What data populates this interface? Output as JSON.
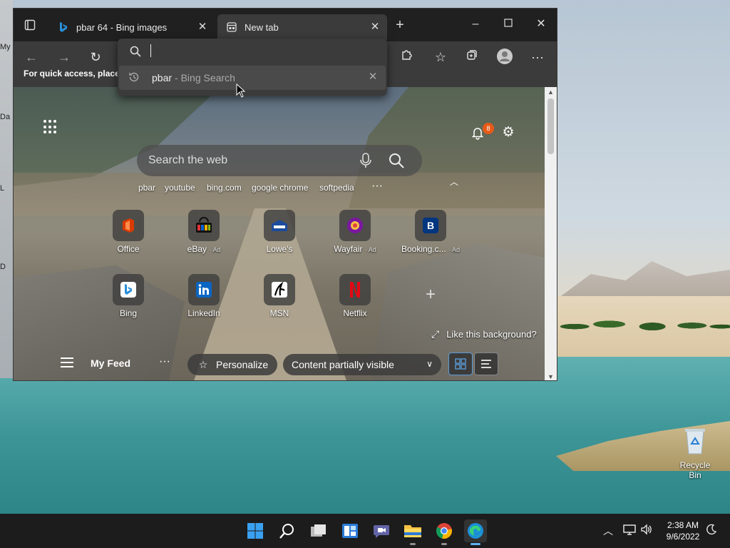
{
  "desktop": {
    "left_labels": [
      "My",
      "Da",
      "L",
      "D"
    ],
    "recycle_bin_label": "Recycle Bin"
  },
  "browser": {
    "tabs": [
      {
        "title": "pbar 64 - Bing images",
        "active": false,
        "icon": "bing-icon"
      },
      {
        "title": "New tab",
        "active": true,
        "icon": "newtab-page-icon"
      }
    ],
    "favorites_bar_text": "For quick access, place y",
    "address_bar": {
      "value": "",
      "suggestion": {
        "query": "pbar",
        "source": " - Bing Search"
      }
    }
  },
  "newtab": {
    "search_placeholder": "Search the web",
    "notification_count": "8",
    "quick_links": [
      "pbar",
      "youtube",
      "bing.com",
      "google chrome",
      "softpedia"
    ],
    "tiles_row1": [
      {
        "label": "Office",
        "ad": "",
        "icon": "office-icon"
      },
      {
        "label": "eBay",
        "ad": "· Ad",
        "icon": "ebay-icon"
      },
      {
        "label": "Lowe's",
        "ad": "",
        "icon": "lowes-icon"
      },
      {
        "label": "Wayfair",
        "ad": "· Ad",
        "icon": "wayfair-icon"
      },
      {
        "label": "Booking.c...",
        "ad": "· Ad",
        "icon": "booking-icon"
      }
    ],
    "tiles_row2": [
      {
        "label": "Bing",
        "ad": "",
        "icon": "bing-icon"
      },
      {
        "label": "LinkedIn",
        "ad": "",
        "icon": "linkedin-icon"
      },
      {
        "label": "MSN",
        "ad": "",
        "icon": "msn-icon"
      },
      {
        "label": "Netflix",
        "ad": "",
        "icon": "netflix-icon"
      }
    ],
    "like_background": "Like this background?",
    "feed": {
      "title": "My Feed",
      "personalize": "Personalize",
      "content_visibility": "Content partially visible"
    }
  },
  "taskbar": {
    "time": "2:38 AM",
    "date": "9/6/2022",
    "apps": [
      "start",
      "search",
      "task-view",
      "widgets",
      "teams-chat",
      "file-explorer",
      "chrome",
      "edge"
    ]
  },
  "colors": {
    "accent": "#5fb2f2",
    "badge": "#e85a17",
    "browser_dark": "#202020",
    "toolbar": "#3b3b3b"
  }
}
